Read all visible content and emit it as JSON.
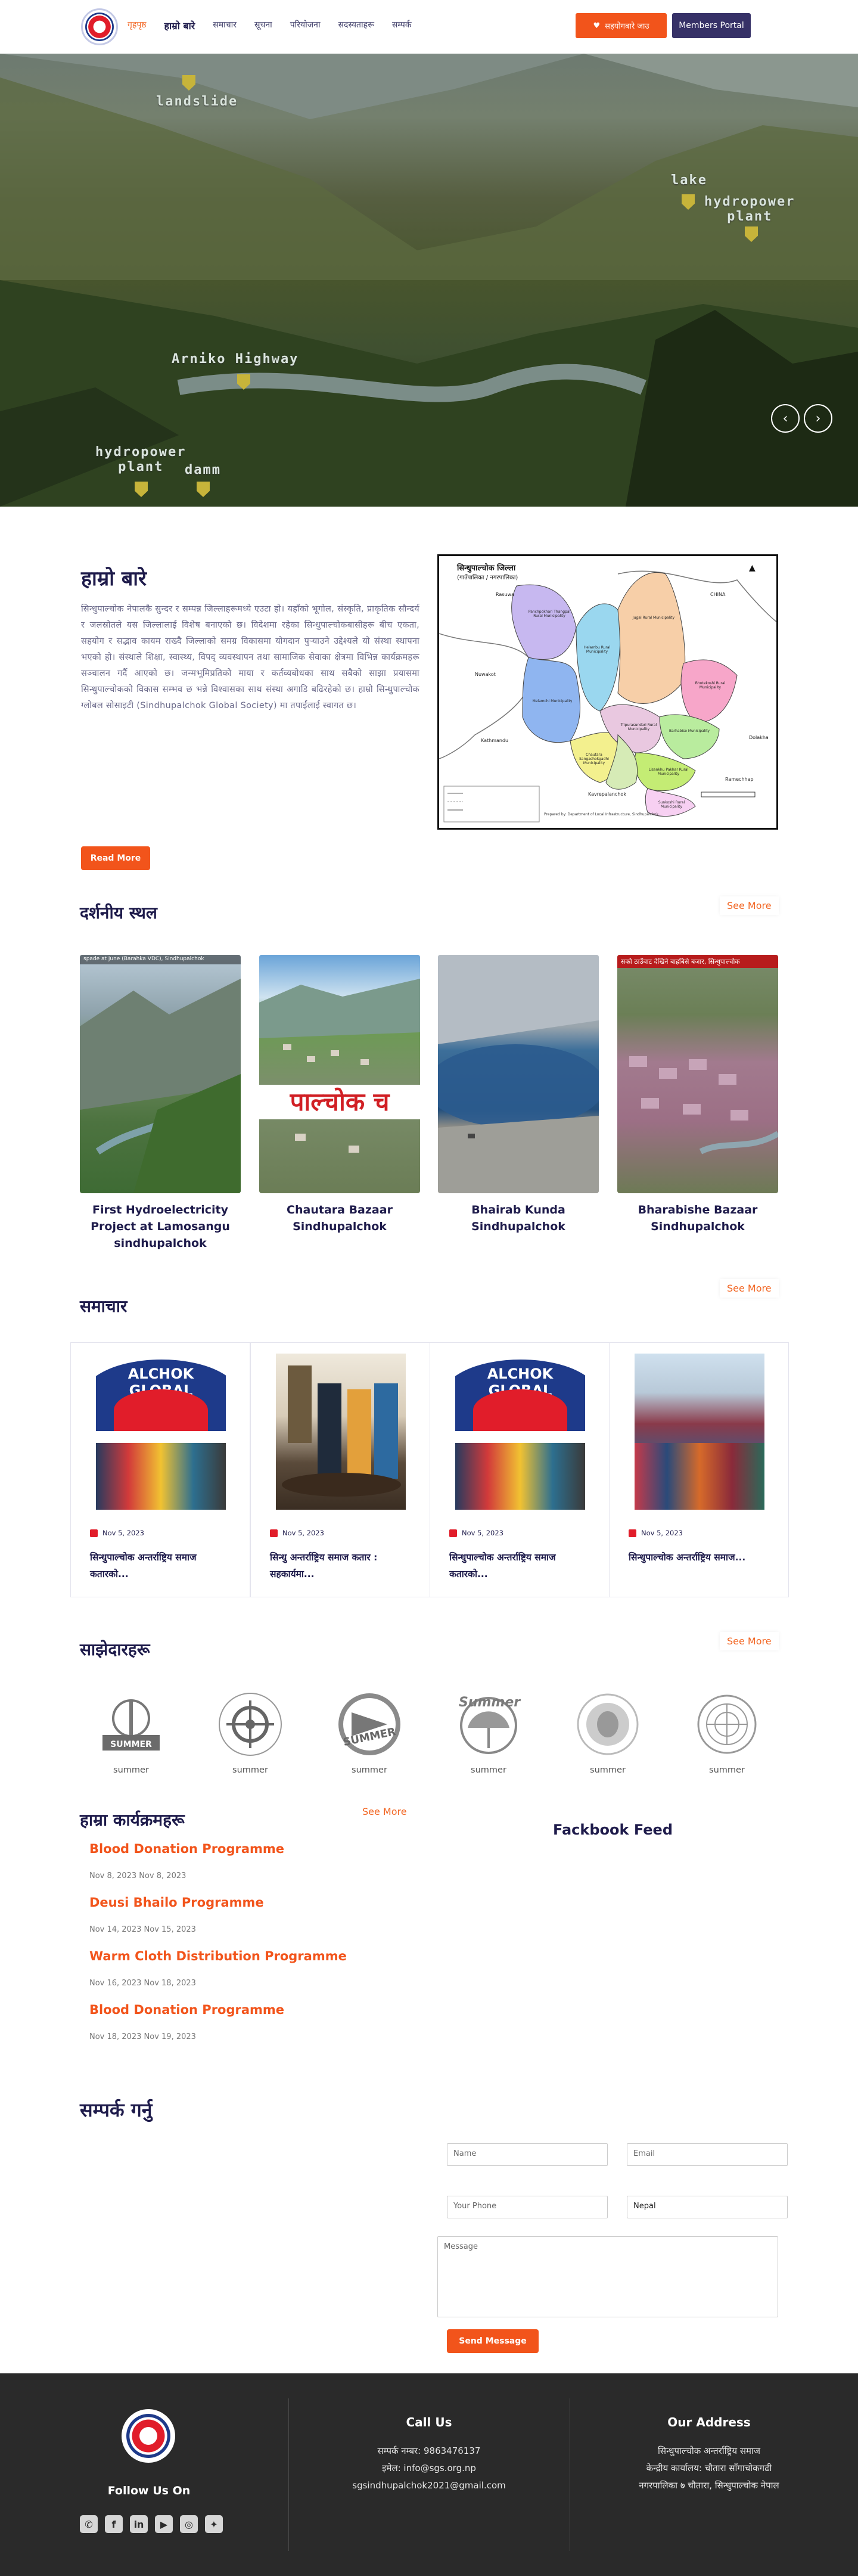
{
  "header": {
    "nav": [
      "गृहपृष्ठ",
      "हाम्रो बारे",
      "समाचार",
      "सूचना",
      "परियोजना",
      "सदस्यताहरू",
      "सम्पर्क"
    ],
    "donate_label": "सहयोगबारे जाउ",
    "members_label": "Members Portal"
  },
  "hero": {
    "labels": {
      "landslide": "landslide",
      "lake": "lake",
      "hydropower_top": "hydropower\nplant",
      "arniko": "Arniko Highway",
      "hydropower_bottom": "hydropower\nplant",
      "damm": "damm"
    }
  },
  "about": {
    "heading": "हाम्रो बारे",
    "body": "सिन्धुपाल्चोक नेपालकै सुन्दर र सम्पन्न जिल्लाहरूमध्ये एउटा हो। यहाँको भूगोल, संस्कृति, प्राकृतिक सौन्दर्य र जलस्रोतले यस जिल्लालाई विशेष बनाएको छ। विदेशमा रहेका सिन्धुपाल्चोकबासीहरू बीच एकता, सहयोग र सद्भाव कायम राख्दै जिल्लाको समग्र विकासमा योगदान पुर्‍याउने उद्देश्यले यो संस्था स्थापना भएको हो। संस्थाले शिक्षा, स्वास्थ्य, विपद् व्यवस्थापन तथा सामाजिक सेवाका क्षेत्रमा विभिन्न कार्यक्रमहरू सञ्चालन गर्दै आएको छ। जन्मभूमिप्रतिको माया र कर्तव्यबोधका साथ सबैको साझा प्रयासमा सिन्धुपाल्चोकको विकास सम्भव छ भन्ने विश्वासका साथ संस्था अगाडि बढिरहेको छ। हाम्रो सिन्धुपाल्चोक ग्लोबल सोसाइटी (Sindhupalchok Global Society) मा तपाईंलाई स्वागत छ।",
    "read_more": "Read More"
  },
  "map": {
    "title_line1": "सिन्धुपाल्चोक जिल्ला",
    "title_line2": "(गाउँपालिका / नगरपालिका)",
    "regions": [
      "Bhotekoshi Rural Municipality",
      "Jugal Rural Municipality",
      "Panchpokhari Thangpal Rural Municipality",
      "Helambu Rural Municipality",
      "Melamchi Municipality",
      "Indrawati Rural Municipality",
      "Chautara Sangachokgadhi Municipality",
      "Balefi Rural Municipality",
      "Barhabise Municipality",
      "Tripurasundari Rural Municipality",
      "Sunkoshi Rural Municipality",
      "Lisankhu Pakhar Rural Municipality"
    ],
    "neighbors": [
      "CHINA",
      "Rasuwa",
      "Nuwakot",
      "Dolakha",
      "Kathmandu",
      "Kavrepalanchok",
      "Ramechhap"
    ],
    "footer_note": "Prepared by: Department of Local Infrastructure, Sindhupalchok"
  },
  "places": {
    "heading": "दर्शनीय स्थल",
    "see_more": "See More",
    "items": [
      {
        "caption": "First Hydroelectricity Project at Lamosangu sindhupalchok",
        "overlay": "spade at june (Barahka VDC), Sindhupalchok"
      },
      {
        "caption": "Chautara Bazaar Sindhupalchok",
        "overlay": "पाल्चोक च"
      },
      {
        "caption": "Bhairab Kunda Sindhupalchok",
        "overlay": ""
      },
      {
        "caption": "Bharabishe Bazaar Sindhupalchok",
        "overlay": "सको ठाउँबाट देखिने बाह्रबिसे बजार, सिन्धुपाल्चोक"
      }
    ]
  },
  "news": {
    "heading": "समाचार",
    "see_more": "See More",
    "items": [
      {
        "date": "Nov 5, 2023",
        "title": "सिन्धुपाल्चोक अन्तर्राष्ट्रिय समाज कतारको...",
        "banner": "ALCHOK GLOBAL"
      },
      {
        "date": "Nov 5, 2023",
        "title": "सिन्धु अन्तर्राष्ट्रिय समाज कतार : सहकार्यमा...",
        "banner": ""
      },
      {
        "date": "Nov 5, 2023",
        "title": "सिन्धुपाल्चोक अन्तर्राष्ट्रिय समाज कतारको...",
        "banner": "ALCHOK GLOBAL"
      },
      {
        "date": "Nov 5, 2023",
        "title": "सिन्धुपाल्चोक अन्तर्राष्ट्रिय समाज...",
        "banner": ""
      }
    ]
  },
  "partners": {
    "heading": "साझेदारहरू",
    "see_more": "See More",
    "items": [
      {
        "caption": "summer",
        "badge": "SUMMER"
      },
      {
        "caption": "summer",
        "badge": ""
      },
      {
        "caption": "summer",
        "badge": "SUMMER"
      },
      {
        "caption": "summer",
        "badge": "Summer"
      },
      {
        "caption": "summer",
        "badge": ""
      },
      {
        "caption": "summer",
        "badge": ""
      }
    ]
  },
  "programs": {
    "heading": "हाम्रा कार्यक्रमहरू",
    "see_more": "See More",
    "items": [
      {
        "title": "Blood Donation Programme",
        "dates": "Nov 8, 2023 Nov 8, 2023"
      },
      {
        "title": "Deusi Bhailo Programme",
        "dates": "Nov 14, 2023 Nov 15, 2023"
      },
      {
        "title": "Warm Cloth Distribution Programme",
        "dates": "Nov 16, 2023 Nov 18, 2023"
      },
      {
        "title": "Blood Donation Programme",
        "dates": "Nov 18, 2023 Nov 19, 2023"
      }
    ],
    "facebook_feed": "Fackbook Feed"
  },
  "contact": {
    "heading": "सम्पर्क गर्नु",
    "name_placeholder": "Name",
    "email_placeholder": "Email",
    "phone_placeholder": "Your Phone",
    "country_value": "Nepal",
    "message_placeholder": "Message",
    "send_label": "Send Message"
  },
  "footer": {
    "follow_us": "Follow Us On",
    "call_us": "Call Us",
    "phone_line": "सम्पर्क नम्बर: 9863476137",
    "email_line1": "इमेल: info@sgs.org.np",
    "email_line2": "sgsindhupalchok2021@gmail.com",
    "our_address": "Our Address",
    "address_line1": "सिन्धुपाल्चोक अन्तर्राष्ट्रिय समाज",
    "address_line2": "केन्द्रीय कार्यालय: चौतारा साँगाचोकगढी",
    "address_line3": "नगरपालिका ७ चौतारा, सिन्धुपाल्चोक नेपाल",
    "social": [
      "phone-icon",
      "facebook-icon",
      "linkedin-icon",
      "youtube-icon",
      "instagram-icon",
      "twitter-icon"
    ]
  },
  "colors": {
    "accent": "#f2541b",
    "brand": "#363167",
    "footer": "#2a2a2a"
  }
}
